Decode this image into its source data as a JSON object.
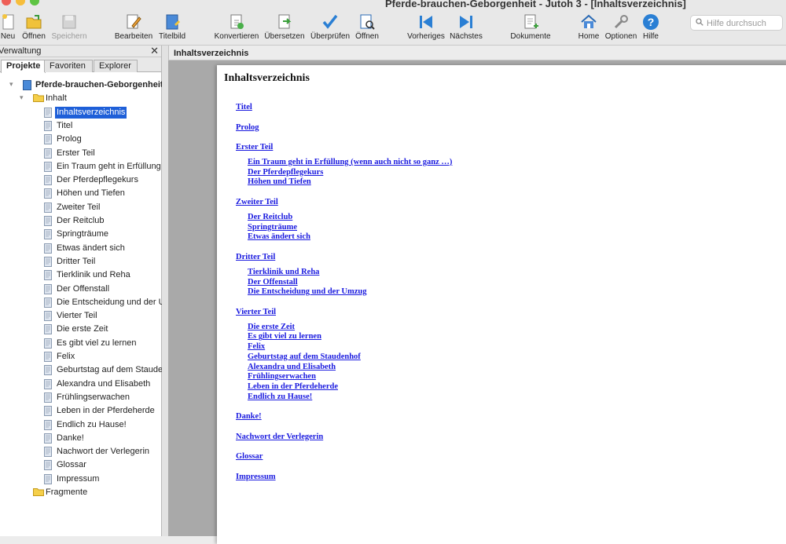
{
  "window": {
    "title": "Pferde-brauchen-Geborgenheit - Jutoh 3 - [Inhaltsverzeichnis]"
  },
  "toolbar": {
    "items": [
      {
        "label": "Neu",
        "icon": "new-document-icon"
      },
      {
        "label": "Öffnen",
        "icon": "open-folder-icon"
      },
      {
        "label": "Speichern",
        "icon": "save-icon"
      },
      {
        "label": "Bearbeiten",
        "icon": "edit-icon"
      },
      {
        "label": "Titelbild",
        "icon": "cover-image-icon"
      },
      {
        "label": "Konvertieren",
        "icon": "convert-icon"
      },
      {
        "label": "Übersetzen",
        "icon": "translate-icon"
      },
      {
        "label": "Überprüfen",
        "icon": "checkmark-icon"
      },
      {
        "label": "Öffnen",
        "icon": "open-book-icon"
      },
      {
        "label": "Vorheriges",
        "icon": "previous-icon"
      },
      {
        "label": "Nächstes",
        "icon": "next-icon"
      },
      {
        "label": "Dokumente",
        "icon": "documents-icon"
      },
      {
        "label": "Home",
        "icon": "home-icon"
      },
      {
        "label": "Optionen",
        "icon": "wrench-icon"
      },
      {
        "label": "Hilfe",
        "icon": "help-icon"
      }
    ],
    "search_placeholder": "Hilfe durchsuch"
  },
  "left_panel": {
    "title": "Verwaltung",
    "tabs": [
      "Projekte",
      "Favoriten",
      "Explorer"
    ],
    "project_name": "Pferde-brauchen-Geborgenheit",
    "folder_content": "Inhalt",
    "documents": [
      "Inhaltsverzeichnis",
      "Titel",
      "Prolog",
      "Erster Teil",
      "Ein Traum geht in Erfüllung",
      "Der Pferdepflegekurs",
      "Höhen und Tiefen",
      "Zweiter Teil",
      "Der Reitclub",
      "Springträume",
      "Etwas ändert sich",
      "Dritter Teil",
      "Tierklinik und Reha",
      "Der Offenstall",
      "Die Entscheidung und der Umzug",
      "Vierter Teil",
      "Die erste Zeit",
      "Es gibt viel zu lernen",
      "Felix",
      "Geburtstag auf dem Staudenhof",
      "Alexandra und Elisabeth",
      "Frühlingserwachen",
      "Leben in der Pferdeherde",
      "Endlich zu Hause!",
      "Danke!",
      "Nachwort der Verlegerin",
      "Glossar",
      "Impressum"
    ],
    "selected_index": 0,
    "folder_fragments": "Fragmente"
  },
  "editor": {
    "tab_title": "Inhaltsverzeichnis",
    "heading": "Inhaltsverzeichnis",
    "toc": [
      {
        "text": "Titel",
        "level": 1
      },
      {
        "text": "Prolog",
        "level": 1
      },
      {
        "text": "Erster Teil",
        "level": 1
      },
      {
        "text": "Ein Traum geht in Erfüllung  (wenn auch nicht so ganz …)",
        "level": 2
      },
      {
        "text": "Der Pferdepflegekurs",
        "level": 2
      },
      {
        "text": "Höhen und Tiefen",
        "level": 2
      },
      {
        "text": "Zweiter Teil",
        "level": 1
      },
      {
        "text": "Der Reitclub",
        "level": 2
      },
      {
        "text": "Springträume",
        "level": 2
      },
      {
        "text": "Etwas ändert sich",
        "level": 2
      },
      {
        "text": "Dritter Teil",
        "level": 1
      },
      {
        "text": "Tierklinik und Reha",
        "level": 2
      },
      {
        "text": "Der Offenstall",
        "level": 2
      },
      {
        "text": "Die Entscheidung und der Umzug",
        "level": 2
      },
      {
        "text": "Vierter Teil",
        "level": 1
      },
      {
        "text": "Die erste Zeit",
        "level": 2
      },
      {
        "text": "Es gibt viel zu lernen",
        "level": 2
      },
      {
        "text": "Felix",
        "level": 2
      },
      {
        "text": "Geburtstag auf dem Staudenhof",
        "level": 2
      },
      {
        "text": "Alexandra und Elisabeth",
        "level": 2
      },
      {
        "text": "Frühlingserwachen",
        "level": 2
      },
      {
        "text": "Leben in der Pferdeherde",
        "level": 2
      },
      {
        "text": "Endlich zu Hause!",
        "level": 2
      },
      {
        "text": "Danke!",
        "level": 1
      },
      {
        "text": "Nachwort der Verlegerin",
        "level": 1
      },
      {
        "text": "Glossar",
        "level": 1
      },
      {
        "text": "Impressum",
        "level": 1
      }
    ]
  },
  "colors": {
    "selection": "#1e5fd8",
    "link": "#1a1adf",
    "accent_blue": "#2a7fd4"
  }
}
